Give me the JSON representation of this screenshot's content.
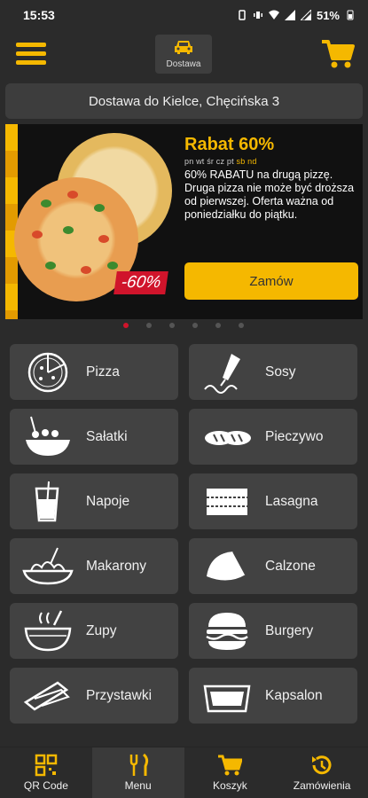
{
  "status": {
    "time": "15:53",
    "battery": "51%"
  },
  "header": {
    "delivery_label": "Dostawa"
  },
  "address": {
    "text": "Dostawa do Kielce, Chęcińska 3"
  },
  "banner": {
    "title": "Rabat 60%",
    "days_inactive": "pn wt śr cz pt",
    "days_active": "sb nd",
    "text": "60% RABATU na drugą pizzę. Druga pizza nie może być droższa od pierwszej. Oferta ważna od poniedziałku do piątku.",
    "discount_tag": "-60%",
    "order_label": "Zamów"
  },
  "carousel": {
    "count": 6,
    "active": 0
  },
  "categories": [
    {
      "label": "Pizza",
      "icon": "pizza-icon"
    },
    {
      "label": "Sosy",
      "icon": "sauce-icon"
    },
    {
      "label": "Sałatki",
      "icon": "salad-icon"
    },
    {
      "label": "Pieczywo",
      "icon": "bread-icon"
    },
    {
      "label": "Napoje",
      "icon": "drink-icon"
    },
    {
      "label": "Lasagna",
      "icon": "lasagna-icon"
    },
    {
      "label": "Makarony",
      "icon": "pasta-icon"
    },
    {
      "label": "Calzone",
      "icon": "calzone-icon"
    },
    {
      "label": "Zupy",
      "icon": "soup-icon"
    },
    {
      "label": "Burgery",
      "icon": "burger-icon"
    },
    {
      "label": "Przystawki",
      "icon": "appetizer-icon"
    },
    {
      "label": "Kapsalon",
      "icon": "kapsalon-icon"
    }
  ],
  "nav": [
    {
      "label": "QR Code",
      "icon": "qr-code-icon"
    },
    {
      "label": "Menu",
      "icon": "menu-cutlery-icon"
    },
    {
      "label": "Koszyk",
      "icon": "cart-icon"
    },
    {
      "label": "Zamówienia",
      "icon": "orders-history-icon"
    }
  ],
  "colors": {
    "accent": "#f5b800",
    "background": "#2b2b2b",
    "tile": "#424242",
    "discount": "#d0142b"
  }
}
